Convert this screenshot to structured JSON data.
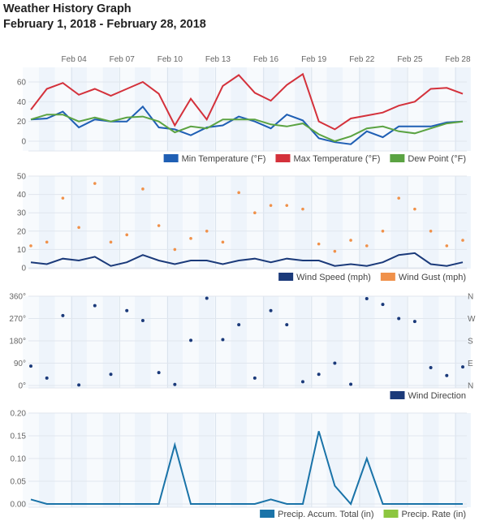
{
  "header": {
    "title": "Weather History Graph",
    "subtitle": "February 1, 2018 - February 28, 2018"
  },
  "x_ticks": [
    "Feb 04",
    "Feb 07",
    "Feb 10",
    "Feb 13",
    "Feb 16",
    "Feb 19",
    "Feb 22",
    "Feb 25",
    "Feb 28"
  ],
  "chart_data": [
    {
      "type": "line",
      "title": "",
      "x": [
        1,
        2,
        3,
        4,
        5,
        6,
        7,
        8,
        9,
        10,
        11,
        12,
        13,
        14,
        15,
        16,
        17,
        18,
        19,
        20,
        21,
        22,
        23,
        24,
        25,
        26,
        27,
        28
      ],
      "x_tick_days": [
        4,
        7,
        10,
        13,
        16,
        19,
        22,
        25,
        28
      ],
      "ylim": [
        -10,
        72
      ],
      "yticks": [
        0,
        20,
        40,
        60
      ],
      "ytick_labels": [
        "0",
        "20",
        "40",
        "60"
      ],
      "legend_position": "bottom-right",
      "series": [
        {
          "name": "Min Temperature (°F)",
          "color": "#1f5fb4",
          "kind": "line",
          "values": [
            22,
            23,
            30,
            14,
            22,
            20,
            20,
            35,
            14,
            12,
            6,
            14,
            16,
            25,
            20,
            13,
            27,
            21,
            3,
            -1,
            -3,
            10,
            4,
            15,
            15,
            15,
            19,
            20
          ]
        },
        {
          "name": "Max Temperature (°F)",
          "color": "#d4313b",
          "kind": "line",
          "values": [
            32,
            53,
            59,
            47,
            53,
            46,
            53,
            60,
            48,
            16,
            43,
            22,
            56,
            67,
            49,
            41,
            57,
            68,
            20,
            12,
            23,
            26,
            29,
            36,
            40,
            53,
            54,
            48
          ]
        },
        {
          "name": "Dew Point (°F)",
          "color": "#5ba342",
          "kind": "line",
          "values": [
            22,
            27,
            27,
            20,
            24,
            20,
            24,
            25,
            20,
            9,
            15,
            13,
            22,
            22,
            22,
            17,
            15,
            18,
            7,
            0,
            5,
            13,
            15,
            10,
            8,
            13,
            18,
            20
          ]
        }
      ]
    },
    {
      "type": "line",
      "title": "",
      "x": [
        1,
        2,
        3,
        4,
        5,
        6,
        7,
        8,
        9,
        10,
        11,
        12,
        13,
        14,
        15,
        16,
        17,
        18,
        19,
        20,
        21,
        22,
        23,
        24,
        25,
        26,
        27,
        28
      ],
      "ylim": [
        0,
        50
      ],
      "yticks": [
        0,
        10,
        20,
        30,
        40,
        50
      ],
      "ytick_labels": [
        "0",
        "10",
        "20",
        "30",
        "40",
        "50"
      ],
      "legend_position": "bottom-right",
      "series": [
        {
          "name": "Wind Speed (mph)",
          "color": "#1b3a7a",
          "kind": "line",
          "values": [
            3,
            2,
            5,
            4,
            6,
            1,
            3,
            7,
            4,
            2,
            4,
            4,
            2,
            4,
            5,
            3,
            5,
            4,
            4,
            1,
            2,
            1,
            3,
            7,
            8,
            2,
            1,
            3
          ]
        },
        {
          "name": "Wind Gust (mph)",
          "color": "#f0914a",
          "kind": "points",
          "values": [
            12,
            14,
            38,
            22,
            46,
            14,
            18,
            43,
            23,
            10,
            16,
            20,
            14,
            41,
            30,
            34,
            34,
            32,
            13,
            9,
            15,
            12,
            20,
            38,
            32,
            20,
            12,
            15
          ]
        }
      ]
    },
    {
      "type": "scatter",
      "title": "",
      "x": [
        1,
        2,
        3,
        4,
        5,
        6,
        7,
        8,
        9,
        10,
        11,
        12,
        13,
        14,
        15,
        16,
        17,
        18,
        19,
        20,
        21,
        22,
        23,
        24,
        25,
        26,
        27,
        28
      ],
      "ylim": [
        0,
        360
      ],
      "yticks": [
        0,
        90,
        180,
        270,
        360
      ],
      "ytick_labels": [
        "0°",
        "90°",
        "180°",
        "270°",
        "360°"
      ],
      "right_tick_labels": [
        "N",
        "E",
        "S",
        "W",
        "N"
      ],
      "legend_position": "bottom-right",
      "series": [
        {
          "name": "Wind Direction",
          "color": "#1b3a7a",
          "kind": "points",
          "values": [
            78,
            30,
            282,
            2,
            322,
            45,
            302,
            262,
            52,
            4,
            182,
            352,
            185,
            245,
            30,
            302,
            245,
            15,
            45,
            90,
            5,
            350,
            327,
            270,
            258,
            72,
            40,
            75
          ]
        }
      ]
    },
    {
      "type": "line",
      "title": "",
      "x": [
        1,
        2,
        3,
        4,
        5,
        6,
        7,
        8,
        9,
        10,
        11,
        12,
        13,
        14,
        15,
        16,
        17,
        18,
        19,
        20,
        21,
        22,
        23,
        24,
        25,
        26,
        27,
        28
      ],
      "ylim": [
        0,
        0.2
      ],
      "yticks": [
        0,
        0.05,
        0.1,
        0.15,
        0.2
      ],
      "ytick_labels": [
        "0.00",
        "0.05",
        "0.10",
        "0.15",
        "0.20"
      ],
      "legend_position": "bottom-right",
      "series": [
        {
          "name": "Precip. Accum. Total (in)",
          "color": "#1a73a8",
          "kind": "line",
          "values": [
            0.01,
            0,
            0,
            0,
            0,
            0,
            0,
            0,
            0,
            0.13,
            0,
            0,
            0,
            0,
            0,
            0.01,
            0,
            0,
            0.16,
            0.04,
            0,
            0.1,
            0,
            0,
            0,
            0,
            0,
            0
          ]
        },
        {
          "name": "Precip. Rate (in)",
          "color": "#8cc63f",
          "kind": "none",
          "values": []
        }
      ]
    }
  ]
}
